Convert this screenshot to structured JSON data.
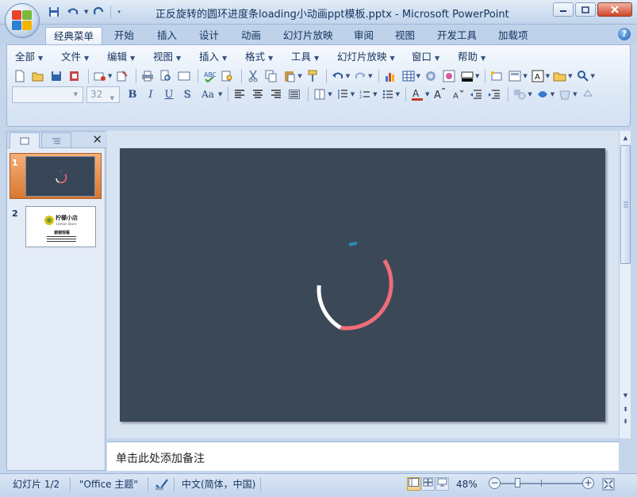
{
  "titlebar": {
    "title": "正反旋转的圆环进度条loading小动画ppt模板.pptx - Microsoft PowerPoint",
    "minimize_icon": "minimize-icon",
    "maximize_icon": "maximize-icon",
    "close_icon": "close-icon"
  },
  "qat": {
    "save": "save-icon",
    "undo": "undo-icon",
    "redo": "redo-icon",
    "customize": "dropdown-icon"
  },
  "tabs": [
    {
      "label": "经典菜单",
      "active": true
    },
    {
      "label": "开始"
    },
    {
      "label": "插入"
    },
    {
      "label": "设计"
    },
    {
      "label": "动画"
    },
    {
      "label": "幻灯片放映"
    },
    {
      "label": "审阅"
    },
    {
      "label": "视图"
    },
    {
      "label": "开发工具"
    },
    {
      "label": "加载项"
    }
  ],
  "menus": [
    "全部",
    "文件",
    "编辑",
    "视图",
    "插入",
    "格式",
    "工具",
    "幻灯片放映",
    "窗口",
    "帮助"
  ],
  "font": {
    "name": "",
    "size": "32"
  },
  "format_buttons": {
    "bold": "B",
    "italic": "I",
    "underline": "U",
    "shadow": "S",
    "change_case": "Aa"
  },
  "panel": {
    "tab1_icon": "slides-icon",
    "tab2_icon": "outline-icon",
    "close": "✕",
    "slides": [
      {
        "number": "1",
        "selected": true
      },
      {
        "number": "2",
        "logo_text": "柠檬小店",
        "subtitle": "Lemon Store",
        "heading": "谢谢观看"
      }
    ]
  },
  "slide": {
    "background": "#3b4858",
    "outer_ring_color": "#ef6d78",
    "white_arc_color": "#ffffff",
    "inner_dash_color": "#2a8ab0"
  },
  "notes": {
    "placeholder": "单击此处添加备注"
  },
  "status": {
    "slide_info": "幻灯片 1/2",
    "theme": "\"Office 主题\"",
    "language": "中文(简体，中国)",
    "zoom": "48%",
    "zoom_fraction": 0.48
  }
}
